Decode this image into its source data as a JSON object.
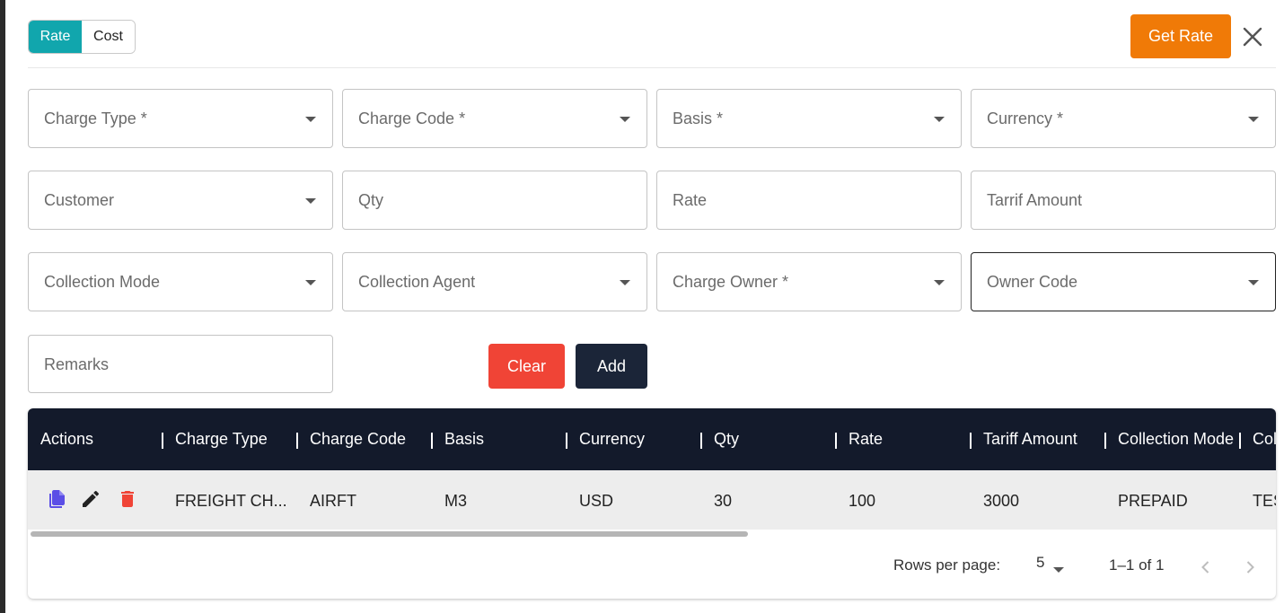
{
  "toggle": {
    "rate_label": "Rate",
    "cost_label": "Cost"
  },
  "header": {
    "get_rate_label": "Get Rate"
  },
  "form": {
    "charge_type": "Charge Type *",
    "charge_code": "Charge Code *",
    "basis": "Basis *",
    "currency": "Currency *",
    "customer": "Customer",
    "qty": "Qty",
    "rate": "Rate",
    "tarrif_amount": "Tarrif Amount",
    "collection_mode": "Collection Mode",
    "collection_agent": "Collection Agent",
    "charge_owner": "Charge Owner *",
    "owner_code": "Owner Code",
    "remarks": "Remarks",
    "clear_label": "Clear",
    "add_label": "Add"
  },
  "table": {
    "columns": [
      "Actions",
      "Charge Type",
      "Charge Code",
      "Basis",
      "Currency",
      "Qty",
      "Rate",
      "Tariff Amount",
      "Collection Mode",
      "Col"
    ],
    "rows": [
      {
        "charge_type": "FREIGHT CH...",
        "charge_code": "AIRFT",
        "basis": "M3",
        "currency": "USD",
        "qty": "30",
        "rate": "100",
        "tariff_amount": "3000",
        "collection_mode": "PREPAID",
        "col": "TES"
      }
    ]
  },
  "pagination": {
    "rows_per_page_label": "Rows per page:",
    "rows_per_page_value": "5",
    "range": "1–1 of 1"
  },
  "colors": {
    "accent": "#11a6ad",
    "get_rate": "#f07a07",
    "clear": "#f04436",
    "header_bg": "#131a2b"
  }
}
